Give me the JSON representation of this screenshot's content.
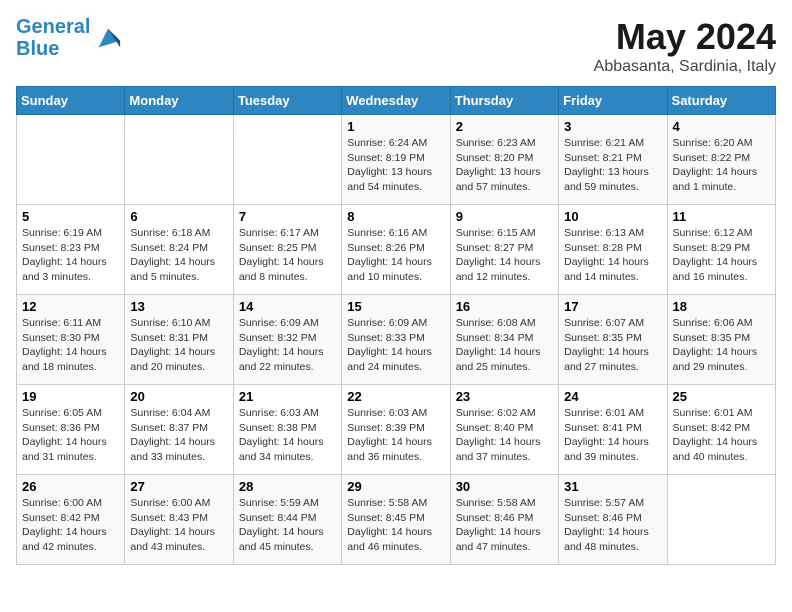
{
  "header": {
    "logo_line1": "General",
    "logo_line2": "Blue",
    "month": "May 2024",
    "location": "Abbasanta, Sardinia, Italy"
  },
  "weekdays": [
    "Sunday",
    "Monday",
    "Tuesday",
    "Wednesday",
    "Thursday",
    "Friday",
    "Saturday"
  ],
  "weeks": [
    [
      {
        "day": "",
        "sunrise": "",
        "sunset": "",
        "daylight": ""
      },
      {
        "day": "",
        "sunrise": "",
        "sunset": "",
        "daylight": ""
      },
      {
        "day": "",
        "sunrise": "",
        "sunset": "",
        "daylight": ""
      },
      {
        "day": "1",
        "sunrise": "Sunrise: 6:24 AM",
        "sunset": "Sunset: 8:19 PM",
        "daylight": "Daylight: 13 hours and 54 minutes."
      },
      {
        "day": "2",
        "sunrise": "Sunrise: 6:23 AM",
        "sunset": "Sunset: 8:20 PM",
        "daylight": "Daylight: 13 hours and 57 minutes."
      },
      {
        "day": "3",
        "sunrise": "Sunrise: 6:21 AM",
        "sunset": "Sunset: 8:21 PM",
        "daylight": "Daylight: 13 hours and 59 minutes."
      },
      {
        "day": "4",
        "sunrise": "Sunrise: 6:20 AM",
        "sunset": "Sunset: 8:22 PM",
        "daylight": "Daylight: 14 hours and 1 minute."
      }
    ],
    [
      {
        "day": "5",
        "sunrise": "Sunrise: 6:19 AM",
        "sunset": "Sunset: 8:23 PM",
        "daylight": "Daylight: 14 hours and 3 minutes."
      },
      {
        "day": "6",
        "sunrise": "Sunrise: 6:18 AM",
        "sunset": "Sunset: 8:24 PM",
        "daylight": "Daylight: 14 hours and 5 minutes."
      },
      {
        "day": "7",
        "sunrise": "Sunrise: 6:17 AM",
        "sunset": "Sunset: 8:25 PM",
        "daylight": "Daylight: 14 hours and 8 minutes."
      },
      {
        "day": "8",
        "sunrise": "Sunrise: 6:16 AM",
        "sunset": "Sunset: 8:26 PM",
        "daylight": "Daylight: 14 hours and 10 minutes."
      },
      {
        "day": "9",
        "sunrise": "Sunrise: 6:15 AM",
        "sunset": "Sunset: 8:27 PM",
        "daylight": "Daylight: 14 hours and 12 minutes."
      },
      {
        "day": "10",
        "sunrise": "Sunrise: 6:13 AM",
        "sunset": "Sunset: 8:28 PM",
        "daylight": "Daylight: 14 hours and 14 minutes."
      },
      {
        "day": "11",
        "sunrise": "Sunrise: 6:12 AM",
        "sunset": "Sunset: 8:29 PM",
        "daylight": "Daylight: 14 hours and 16 minutes."
      }
    ],
    [
      {
        "day": "12",
        "sunrise": "Sunrise: 6:11 AM",
        "sunset": "Sunset: 8:30 PM",
        "daylight": "Daylight: 14 hours and 18 minutes."
      },
      {
        "day": "13",
        "sunrise": "Sunrise: 6:10 AM",
        "sunset": "Sunset: 8:31 PM",
        "daylight": "Daylight: 14 hours and 20 minutes."
      },
      {
        "day": "14",
        "sunrise": "Sunrise: 6:09 AM",
        "sunset": "Sunset: 8:32 PM",
        "daylight": "Daylight: 14 hours and 22 minutes."
      },
      {
        "day": "15",
        "sunrise": "Sunrise: 6:09 AM",
        "sunset": "Sunset: 8:33 PM",
        "daylight": "Daylight: 14 hours and 24 minutes."
      },
      {
        "day": "16",
        "sunrise": "Sunrise: 6:08 AM",
        "sunset": "Sunset: 8:34 PM",
        "daylight": "Daylight: 14 hours and 25 minutes."
      },
      {
        "day": "17",
        "sunrise": "Sunrise: 6:07 AM",
        "sunset": "Sunset: 8:35 PM",
        "daylight": "Daylight: 14 hours and 27 minutes."
      },
      {
        "day": "18",
        "sunrise": "Sunrise: 6:06 AM",
        "sunset": "Sunset: 8:35 PM",
        "daylight": "Daylight: 14 hours and 29 minutes."
      }
    ],
    [
      {
        "day": "19",
        "sunrise": "Sunrise: 6:05 AM",
        "sunset": "Sunset: 8:36 PM",
        "daylight": "Daylight: 14 hours and 31 minutes."
      },
      {
        "day": "20",
        "sunrise": "Sunrise: 6:04 AM",
        "sunset": "Sunset: 8:37 PM",
        "daylight": "Daylight: 14 hours and 33 minutes."
      },
      {
        "day": "21",
        "sunrise": "Sunrise: 6:03 AM",
        "sunset": "Sunset: 8:38 PM",
        "daylight": "Daylight: 14 hours and 34 minutes."
      },
      {
        "day": "22",
        "sunrise": "Sunrise: 6:03 AM",
        "sunset": "Sunset: 8:39 PM",
        "daylight": "Daylight: 14 hours and 36 minutes."
      },
      {
        "day": "23",
        "sunrise": "Sunrise: 6:02 AM",
        "sunset": "Sunset: 8:40 PM",
        "daylight": "Daylight: 14 hours and 37 minutes."
      },
      {
        "day": "24",
        "sunrise": "Sunrise: 6:01 AM",
        "sunset": "Sunset: 8:41 PM",
        "daylight": "Daylight: 14 hours and 39 minutes."
      },
      {
        "day": "25",
        "sunrise": "Sunrise: 6:01 AM",
        "sunset": "Sunset: 8:42 PM",
        "daylight": "Daylight: 14 hours and 40 minutes."
      }
    ],
    [
      {
        "day": "26",
        "sunrise": "Sunrise: 6:00 AM",
        "sunset": "Sunset: 8:42 PM",
        "daylight": "Daylight: 14 hours and 42 minutes."
      },
      {
        "day": "27",
        "sunrise": "Sunrise: 6:00 AM",
        "sunset": "Sunset: 8:43 PM",
        "daylight": "Daylight: 14 hours and 43 minutes."
      },
      {
        "day": "28",
        "sunrise": "Sunrise: 5:59 AM",
        "sunset": "Sunset: 8:44 PM",
        "daylight": "Daylight: 14 hours and 45 minutes."
      },
      {
        "day": "29",
        "sunrise": "Sunrise: 5:58 AM",
        "sunset": "Sunset: 8:45 PM",
        "daylight": "Daylight: 14 hours and 46 minutes."
      },
      {
        "day": "30",
        "sunrise": "Sunrise: 5:58 AM",
        "sunset": "Sunset: 8:46 PM",
        "daylight": "Daylight: 14 hours and 47 minutes."
      },
      {
        "day": "31",
        "sunrise": "Sunrise: 5:57 AM",
        "sunset": "Sunset: 8:46 PM",
        "daylight": "Daylight: 14 hours and 48 minutes."
      },
      {
        "day": "",
        "sunrise": "",
        "sunset": "",
        "daylight": ""
      }
    ]
  ]
}
